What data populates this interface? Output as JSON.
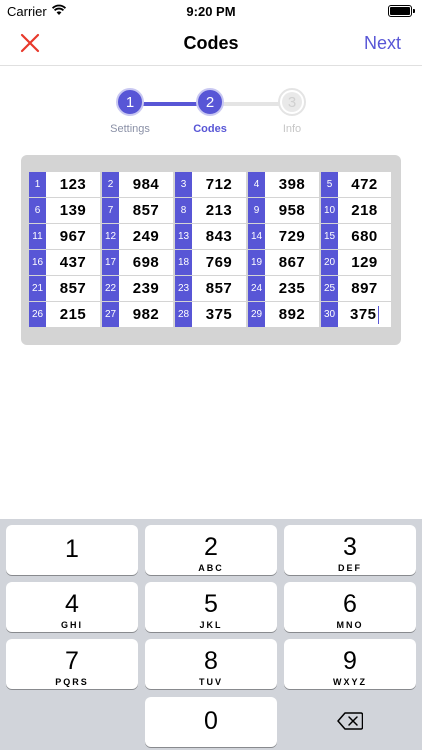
{
  "status_bar": {
    "carrier": "Carrier",
    "time": "9:20 PM"
  },
  "nav": {
    "title": "Codes",
    "next_label": "Next",
    "accent_color": "#5856d6",
    "close_color": "#e8392b"
  },
  "stepper": {
    "steps": [
      {
        "number": "1",
        "label": "Settings",
        "state": "done"
      },
      {
        "number": "2",
        "label": "Codes",
        "state": "current"
      },
      {
        "number": "3",
        "label": "Info",
        "state": "upcoming"
      }
    ]
  },
  "codes": {
    "rows": [
      [
        {
          "n": "1",
          "v": "123"
        },
        {
          "n": "2",
          "v": "984"
        },
        {
          "n": "3",
          "v": "712"
        },
        {
          "n": "4",
          "v": "398"
        },
        {
          "n": "5",
          "v": "472"
        }
      ],
      [
        {
          "n": "6",
          "v": "139"
        },
        {
          "n": "7",
          "v": "857"
        },
        {
          "n": "8",
          "v": "213"
        },
        {
          "n": "9",
          "v": "958"
        },
        {
          "n": "10",
          "v": "218"
        }
      ],
      [
        {
          "n": "11",
          "v": "967"
        },
        {
          "n": "12",
          "v": "249"
        },
        {
          "n": "13",
          "v": "843"
        },
        {
          "n": "14",
          "v": "729"
        },
        {
          "n": "15",
          "v": "680"
        }
      ],
      [
        {
          "n": "16",
          "v": "437"
        },
        {
          "n": "17",
          "v": "698"
        },
        {
          "n": "18",
          "v": "769"
        },
        {
          "n": "19",
          "v": "867"
        },
        {
          "n": "20",
          "v": "129"
        }
      ],
      [
        {
          "n": "21",
          "v": "857"
        },
        {
          "n": "22",
          "v": "239"
        },
        {
          "n": "23",
          "v": "857"
        },
        {
          "n": "24",
          "v": "235"
        },
        {
          "n": "25",
          "v": "897"
        }
      ],
      [
        {
          "n": "26",
          "v": "215"
        },
        {
          "n": "27",
          "v": "982"
        },
        {
          "n": "28",
          "v": "375"
        },
        {
          "n": "29",
          "v": "892"
        },
        {
          "n": "30",
          "v": "375"
        }
      ]
    ]
  },
  "keyboard": {
    "keys": [
      {
        "digit": "1",
        "letters": ""
      },
      {
        "digit": "2",
        "letters": "ABC"
      },
      {
        "digit": "3",
        "letters": "DEF"
      },
      {
        "digit": "4",
        "letters": "GHI"
      },
      {
        "digit": "5",
        "letters": "JKL"
      },
      {
        "digit": "6",
        "letters": "MNO"
      },
      {
        "digit": "7",
        "letters": "PQRS"
      },
      {
        "digit": "8",
        "letters": "TUV"
      },
      {
        "digit": "9",
        "letters": "WXYZ"
      },
      {
        "digit": "0",
        "letters": ""
      }
    ],
    "backspace_icon": "backspace-icon"
  }
}
